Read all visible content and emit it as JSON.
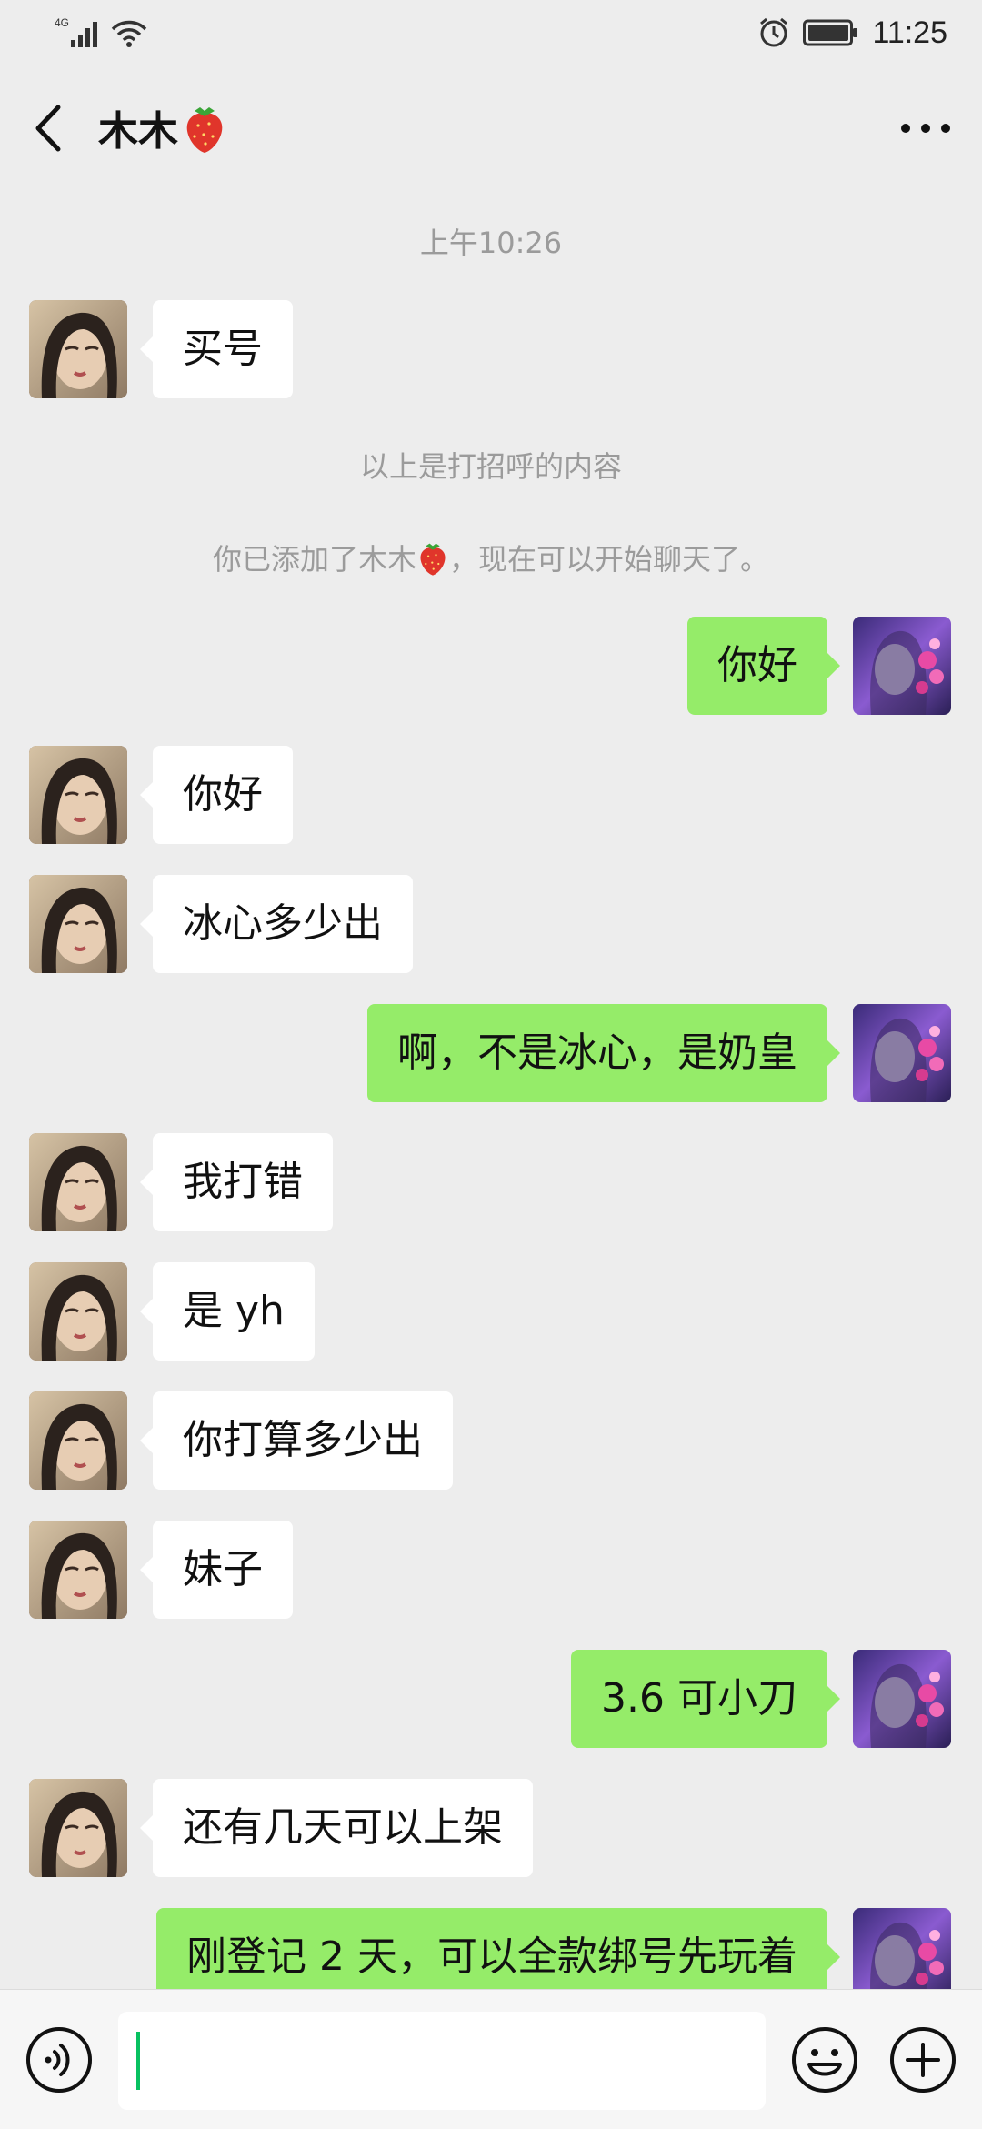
{
  "status_bar": {
    "network": "4G",
    "time": "11:25",
    "icons": [
      "signal-icon",
      "wifi-icon",
      "alarm-icon",
      "battery-icon"
    ]
  },
  "header": {
    "title": "木木",
    "title_emoji": "strawberry-icon",
    "back_icon": "chevron-left-icon",
    "more_icon": "more-icon"
  },
  "messages": {
    "timestamp": "上午10:26",
    "m1": "买号",
    "notice_greeting": "以上是打招呼的内容",
    "notice_added_prefix": "你已添加了木木",
    "notice_added_suffix": "，现在可以开始聊天了。",
    "m2": "你好",
    "m3": "你好",
    "m4": "冰心多少出",
    "m5": "啊，不是冰心，是奶皇",
    "m6": "我打错",
    "m7": "是 yh",
    "m8": "你打算多少出",
    "m9": "妹子",
    "m10": "3.6 可小刀",
    "m11": "还有几天可以上架",
    "m12": "刚登记 2 天，可以全款绑号先玩着"
  },
  "input_bar": {
    "voice_icon": "voice-icon",
    "emoji_icon": "emoji-icon",
    "plus_icon": "plus-icon",
    "input_value": ""
  },
  "colors": {
    "background": "#ededed",
    "incoming_bubble": "#ffffff",
    "outgoing_bubble": "#95ec69",
    "system_text": "#9b9b9b",
    "caret": "#07c160"
  }
}
